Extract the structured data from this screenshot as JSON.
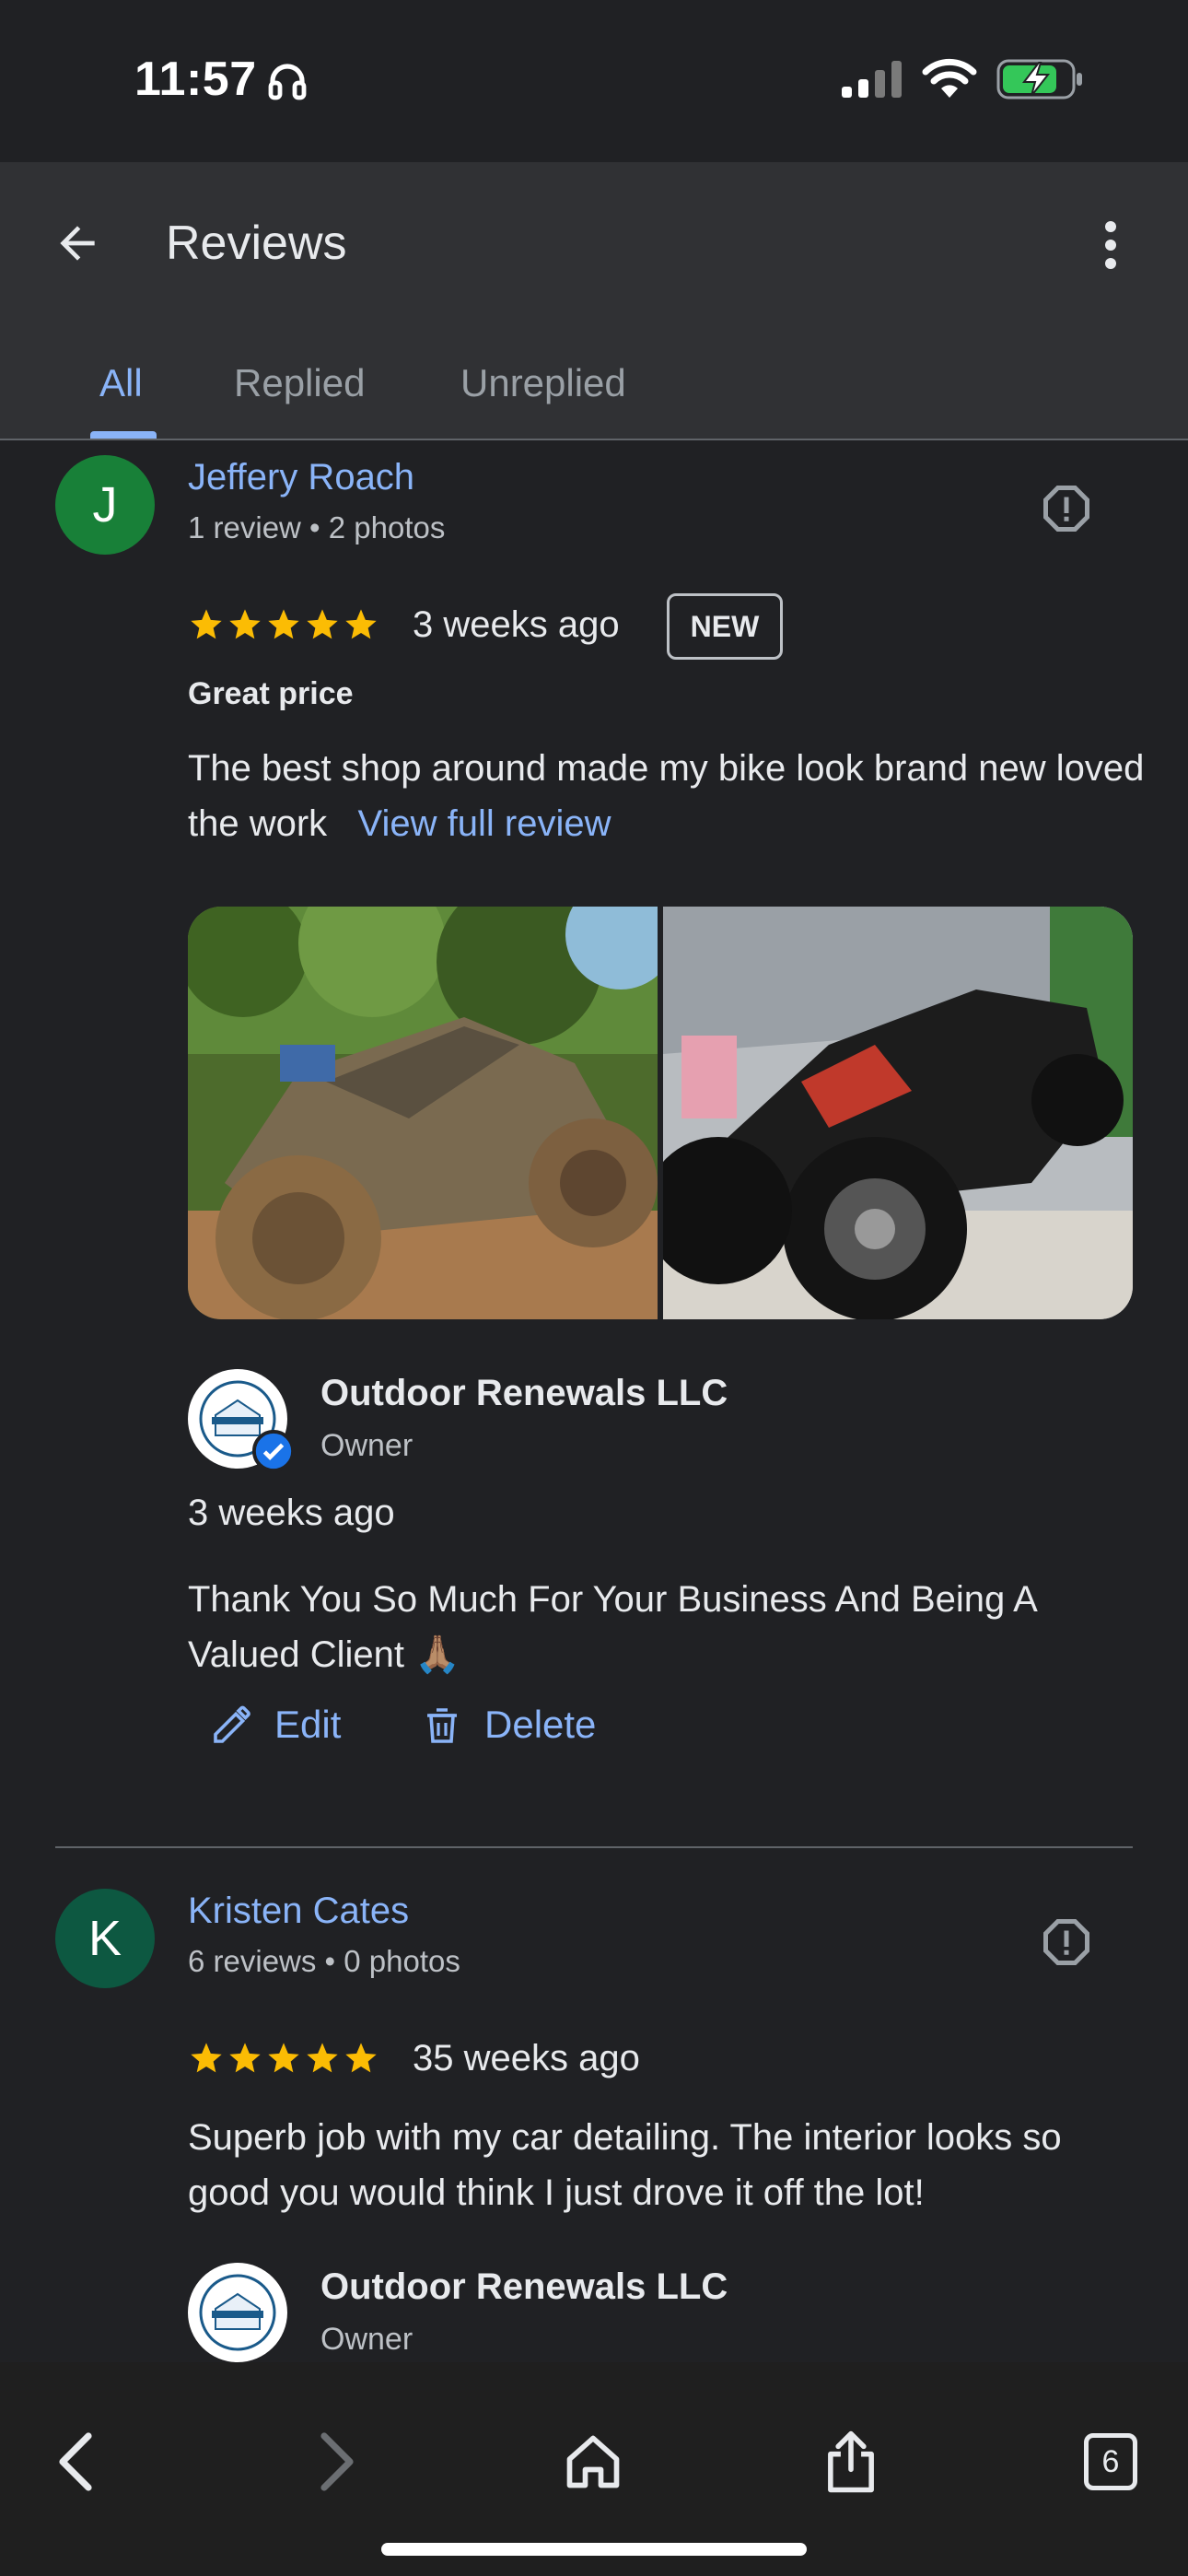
{
  "status_bar": {
    "time": "11:57"
  },
  "app_bar": {
    "title": "Reviews",
    "tabs": [
      {
        "label": "All",
        "active": true
      },
      {
        "label": "Replied",
        "active": false
      },
      {
        "label": "Unreplied",
        "active": false
      }
    ]
  },
  "reviews": [
    {
      "avatar_letter": "J",
      "avatar_color": "#188038",
      "name": "Jeffery Roach",
      "meta": "1 review • 2 photos",
      "rating": 5,
      "time": "3 weeks ago",
      "badge": "NEW",
      "heading": "Great price",
      "text": "The best shop around made my bike look brand new loved the work",
      "view_full_label": "View full review",
      "reply": {
        "owner_name": "Outdoor Renewals LLC",
        "owner_role": "Owner",
        "time": "3 weeks ago",
        "text": "Thank You So Much For Your Business And Being A Valued Client 🙏🏽",
        "edit_label": "Edit",
        "delete_label": "Delete"
      }
    },
    {
      "avatar_letter": "K",
      "avatar_color": "#0d5841",
      "name": "Kristen Cates",
      "meta": "6 reviews • 0 photos",
      "rating": 5,
      "time": "35 weeks ago",
      "text": "Superb job with my car detailing. The interior looks so good you would think I just drove it off the lot!",
      "reply": {
        "owner_name": "Outdoor Renewals LLC",
        "owner_role": "Owner"
      }
    }
  ],
  "toolbar": {
    "tab_count": "6"
  },
  "colors": {
    "accent": "#8ab4f8",
    "star": "#fbbc04",
    "background": "#202124"
  }
}
